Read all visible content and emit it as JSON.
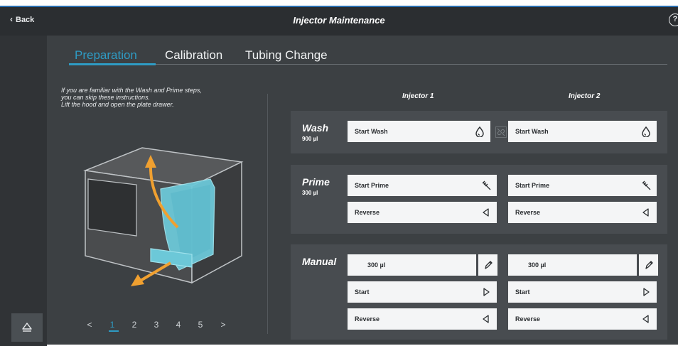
{
  "header": {
    "back_label": "Back",
    "title": "Injector Maintenance",
    "help_label": "?"
  },
  "tabs": [
    {
      "label": "Preparation",
      "active": true
    },
    {
      "label": "Calibration",
      "active": false
    },
    {
      "label": "Tubing Change",
      "active": false
    }
  ],
  "instructions": {
    "line1": "If you are familiar with the Wash and Prime steps,",
    "line2": "you can skip these instructions.",
    "line3": "Lift the hood and open the plate drawer."
  },
  "pager": {
    "prev": "<",
    "pages": [
      "1",
      "2",
      "3",
      "4",
      "5"
    ],
    "current": "1",
    "next": ">"
  },
  "columns": {
    "injector1": "Injector 1",
    "injector2": "Injector 2"
  },
  "wash": {
    "label": "Wash",
    "volume": "900 µl",
    "inj1_button": "Start Wash",
    "inj2_button": "Start Wash"
  },
  "prime": {
    "label": "Prime",
    "volume": "300 µl",
    "inj1_start": "Start Prime",
    "inj1_reverse": "Reverse",
    "inj2_start": "Start Prime",
    "inj2_reverse": "Reverse"
  },
  "manual": {
    "label": "Manual",
    "inj1_volume": "300 µl",
    "inj1_start": "Start",
    "inj1_reverse": "Reverse",
    "inj2_volume": "300 µl",
    "inj2_start": "Start",
    "inj2_reverse": "Reverse"
  },
  "colors": {
    "accent": "#2e9bc4",
    "header_bg": "#2b2e31",
    "panel_bg": "#484c50",
    "arrow": "#f0a030",
    "highlight": "#6cc8d8"
  }
}
